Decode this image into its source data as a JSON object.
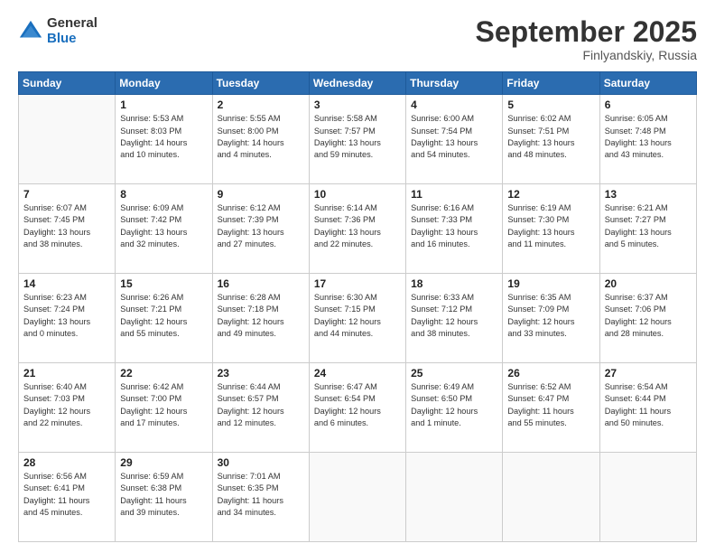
{
  "logo": {
    "general": "General",
    "blue": "Blue"
  },
  "header": {
    "month": "September 2025",
    "location": "Finlyandskiy, Russia"
  },
  "weekdays": [
    "Sunday",
    "Monday",
    "Tuesday",
    "Wednesday",
    "Thursday",
    "Friday",
    "Saturday"
  ],
  "weeks": [
    [
      {
        "day": "",
        "info": ""
      },
      {
        "day": "1",
        "info": "Sunrise: 5:53 AM\nSunset: 8:03 PM\nDaylight: 14 hours\nand 10 minutes."
      },
      {
        "day": "2",
        "info": "Sunrise: 5:55 AM\nSunset: 8:00 PM\nDaylight: 14 hours\nand 4 minutes."
      },
      {
        "day": "3",
        "info": "Sunrise: 5:58 AM\nSunset: 7:57 PM\nDaylight: 13 hours\nand 59 minutes."
      },
      {
        "day": "4",
        "info": "Sunrise: 6:00 AM\nSunset: 7:54 PM\nDaylight: 13 hours\nand 54 minutes."
      },
      {
        "day": "5",
        "info": "Sunrise: 6:02 AM\nSunset: 7:51 PM\nDaylight: 13 hours\nand 48 minutes."
      },
      {
        "day": "6",
        "info": "Sunrise: 6:05 AM\nSunset: 7:48 PM\nDaylight: 13 hours\nand 43 minutes."
      }
    ],
    [
      {
        "day": "7",
        "info": "Sunrise: 6:07 AM\nSunset: 7:45 PM\nDaylight: 13 hours\nand 38 minutes."
      },
      {
        "day": "8",
        "info": "Sunrise: 6:09 AM\nSunset: 7:42 PM\nDaylight: 13 hours\nand 32 minutes."
      },
      {
        "day": "9",
        "info": "Sunrise: 6:12 AM\nSunset: 7:39 PM\nDaylight: 13 hours\nand 27 minutes."
      },
      {
        "day": "10",
        "info": "Sunrise: 6:14 AM\nSunset: 7:36 PM\nDaylight: 13 hours\nand 22 minutes."
      },
      {
        "day": "11",
        "info": "Sunrise: 6:16 AM\nSunset: 7:33 PM\nDaylight: 13 hours\nand 16 minutes."
      },
      {
        "day": "12",
        "info": "Sunrise: 6:19 AM\nSunset: 7:30 PM\nDaylight: 13 hours\nand 11 minutes."
      },
      {
        "day": "13",
        "info": "Sunrise: 6:21 AM\nSunset: 7:27 PM\nDaylight: 13 hours\nand 5 minutes."
      }
    ],
    [
      {
        "day": "14",
        "info": "Sunrise: 6:23 AM\nSunset: 7:24 PM\nDaylight: 13 hours\nand 0 minutes."
      },
      {
        "day": "15",
        "info": "Sunrise: 6:26 AM\nSunset: 7:21 PM\nDaylight: 12 hours\nand 55 minutes."
      },
      {
        "day": "16",
        "info": "Sunrise: 6:28 AM\nSunset: 7:18 PM\nDaylight: 12 hours\nand 49 minutes."
      },
      {
        "day": "17",
        "info": "Sunrise: 6:30 AM\nSunset: 7:15 PM\nDaylight: 12 hours\nand 44 minutes."
      },
      {
        "day": "18",
        "info": "Sunrise: 6:33 AM\nSunset: 7:12 PM\nDaylight: 12 hours\nand 38 minutes."
      },
      {
        "day": "19",
        "info": "Sunrise: 6:35 AM\nSunset: 7:09 PM\nDaylight: 12 hours\nand 33 minutes."
      },
      {
        "day": "20",
        "info": "Sunrise: 6:37 AM\nSunset: 7:06 PM\nDaylight: 12 hours\nand 28 minutes."
      }
    ],
    [
      {
        "day": "21",
        "info": "Sunrise: 6:40 AM\nSunset: 7:03 PM\nDaylight: 12 hours\nand 22 minutes."
      },
      {
        "day": "22",
        "info": "Sunrise: 6:42 AM\nSunset: 7:00 PM\nDaylight: 12 hours\nand 17 minutes."
      },
      {
        "day": "23",
        "info": "Sunrise: 6:44 AM\nSunset: 6:57 PM\nDaylight: 12 hours\nand 12 minutes."
      },
      {
        "day": "24",
        "info": "Sunrise: 6:47 AM\nSunset: 6:54 PM\nDaylight: 12 hours\nand 6 minutes."
      },
      {
        "day": "25",
        "info": "Sunrise: 6:49 AM\nSunset: 6:50 PM\nDaylight: 12 hours\nand 1 minute."
      },
      {
        "day": "26",
        "info": "Sunrise: 6:52 AM\nSunset: 6:47 PM\nDaylight: 11 hours\nand 55 minutes."
      },
      {
        "day": "27",
        "info": "Sunrise: 6:54 AM\nSunset: 6:44 PM\nDaylight: 11 hours\nand 50 minutes."
      }
    ],
    [
      {
        "day": "28",
        "info": "Sunrise: 6:56 AM\nSunset: 6:41 PM\nDaylight: 11 hours\nand 45 minutes."
      },
      {
        "day": "29",
        "info": "Sunrise: 6:59 AM\nSunset: 6:38 PM\nDaylight: 11 hours\nand 39 minutes."
      },
      {
        "day": "30",
        "info": "Sunrise: 7:01 AM\nSunset: 6:35 PM\nDaylight: 11 hours\nand 34 minutes."
      },
      {
        "day": "",
        "info": ""
      },
      {
        "day": "",
        "info": ""
      },
      {
        "day": "",
        "info": ""
      },
      {
        "day": "",
        "info": ""
      }
    ]
  ]
}
